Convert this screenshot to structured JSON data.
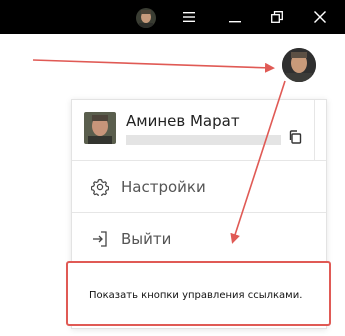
{
  "titlebar": {
    "avatar_icon": "user-avatar-icon",
    "buttons": [
      {
        "name": "menu-icon"
      },
      {
        "name": "minimize-icon"
      },
      {
        "name": "restore-icon"
      },
      {
        "name": "close-icon"
      }
    ],
    "background": "#000000"
  },
  "profile_menu": {
    "user_name": "Аминев Марат",
    "settings_label": "Настройки",
    "logout_label": "Выйти"
  },
  "annotation": {
    "text": "Показать кнопки управления ссылками.",
    "border_color": "#e05a55"
  }
}
